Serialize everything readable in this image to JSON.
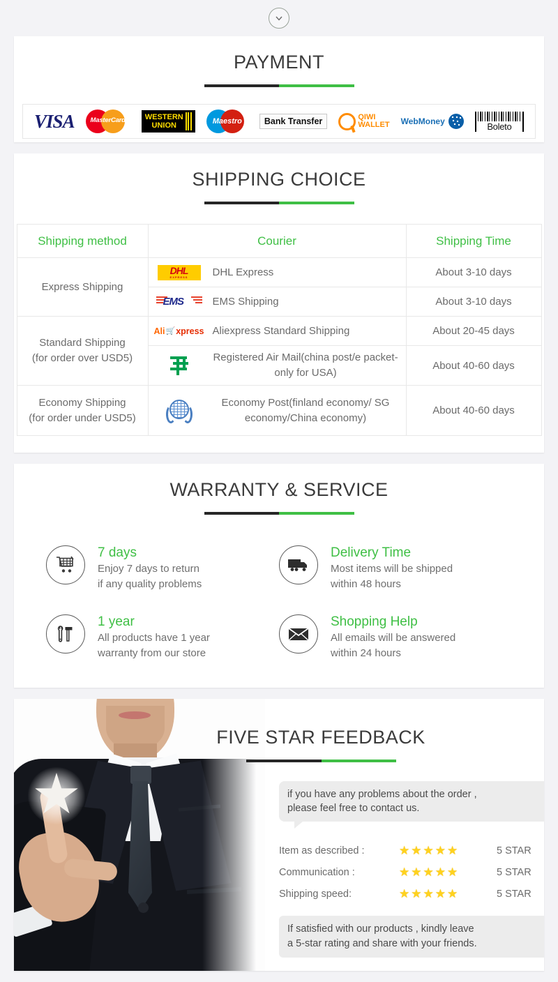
{
  "top": {
    "chevron_icon": "chevron-down-icon"
  },
  "payment": {
    "title": "PAYMENT",
    "methods": [
      {
        "name": "visa",
        "label": "VISA"
      },
      {
        "name": "mastercard",
        "label": "MasterCard"
      },
      {
        "name": "western-union",
        "line1": "WESTERN",
        "line2": "UNION"
      },
      {
        "name": "maestro",
        "label": "Maestro"
      },
      {
        "name": "bank-transfer",
        "label": "Bank Transfer"
      },
      {
        "name": "qiwi-wallet",
        "line1": "QIWI",
        "line2": "WALLET"
      },
      {
        "name": "webmoney",
        "label": "WebMoney"
      },
      {
        "name": "boleto",
        "label": "Boleto"
      }
    ]
  },
  "shipping": {
    "title": "SHIPPING CHOICE",
    "columns": [
      "Shipping method",
      "Courier",
      "Shipping Time"
    ],
    "rows": [
      {
        "method": "Express Shipping",
        "method_note": "",
        "entries": [
          {
            "logo": "dhl-logo",
            "courier": "DHL Express",
            "time": "About 3-10 days"
          },
          {
            "logo": "ems-logo",
            "courier": "EMS Shipping",
            "time": "About 3-10 days"
          }
        ]
      },
      {
        "method": "Standard Shipping",
        "method_note": "(for order over USD5)",
        "entries": [
          {
            "logo": "aliexpress-logo",
            "courier": "Aliexpress Standard Shipping",
            "time": "About 20-45 days"
          },
          {
            "logo": "china-post-logo",
            "courier": "Registered Air Mail(china post/e packet-only for USA)",
            "time": "About 40-60 days"
          }
        ]
      },
      {
        "method": "Economy Shipping",
        "method_note": "(for order under USD5)",
        "entries": [
          {
            "logo": "un-logo",
            "courier": "Economy Post(finland economy/ SG economy/China economy)",
            "time": "About 40-60 days"
          }
        ]
      }
    ]
  },
  "warranty": {
    "title": "WARRANTY & SERVICE",
    "items": [
      {
        "icon": "shopping-cart-icon",
        "head": "7 days",
        "line1": "Enjoy 7 days to return",
        "line2": "if any quality problems"
      },
      {
        "icon": "truck-icon",
        "head": "Delivery Time",
        "line1": "Most items will be shipped",
        "line2": "within 48 hours"
      },
      {
        "icon": "tools-icon",
        "head": "1 year",
        "line1": "All products have 1 year",
        "line2": "warranty from our store"
      },
      {
        "icon": "envelope-icon",
        "head": "Shopping Help",
        "line1": "All emails will be answered",
        "line2": "within 24 hours"
      }
    ]
  },
  "feedback": {
    "title": "FIVE STAR FEEDBACK",
    "bubble_line1": "if you have any problems about the order ,",
    "bubble_line2": "please feel free to contact us.",
    "ratings": [
      {
        "label": "Item as described :",
        "stars": 5,
        "value": "5 STAR"
      },
      {
        "label": "Communication :",
        "stars": 5,
        "value": "5 STAR"
      },
      {
        "label": "Shipping speed:",
        "stars": 5,
        "value": "5 STAR"
      }
    ],
    "footer_line1": "If satisfied with our products , kindly leave",
    "footer_line2": "a 5-star rating and share with your friends.",
    "photo_alt": "businessman-pointing-at-star"
  },
  "colors": {
    "green": "#3fbf45",
    "dark": "#262626",
    "text_gray": "#6b6b6b",
    "star_yellow": "#ffd21e"
  }
}
